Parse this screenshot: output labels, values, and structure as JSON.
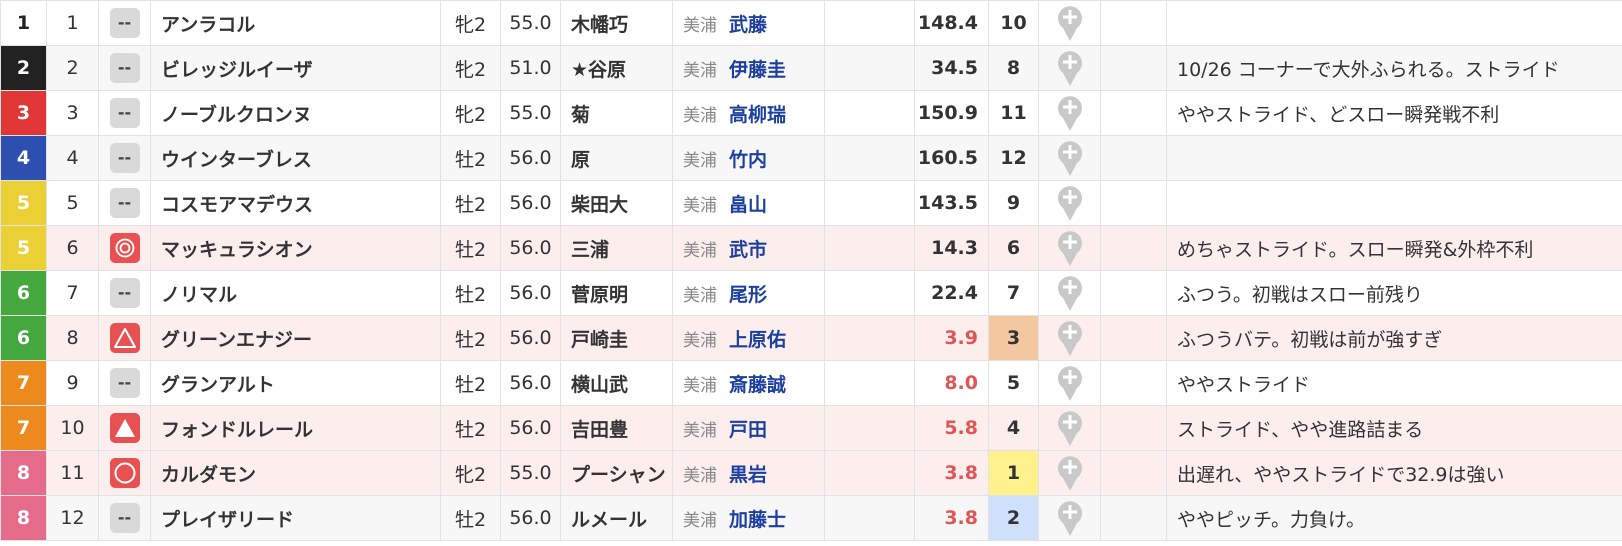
{
  "colors": {
    "waku": {
      "1": {
        "bg": "#ffffff",
        "fg": "#222222"
      },
      "2": {
        "bg": "#222222",
        "fg": "#ffffff"
      },
      "3": {
        "bg": "#e03636",
        "fg": "#ffffff"
      },
      "4": {
        "bg": "#2d4fb0",
        "fg": "#ffffff"
      },
      "5": {
        "bg": "#ead035",
        "fg": "#ffffff"
      },
      "6": {
        "bg": "#45a83e",
        "fg": "#ffffff"
      },
      "7": {
        "bg": "#ec8a1e",
        "fg": "#ffffff"
      },
      "8": {
        "bg": "#e46c8a",
        "fg": "#ffffff"
      }
    },
    "name_blue": "#1d3fa0",
    "odds_favored_red": "#e05656",
    "mark_red": "#e85151",
    "pop1_yellow": "#fff28c",
    "pop2_blue": "#cfe0fb",
    "pop3_orange": "#f3c8a0"
  },
  "runners": [
    {
      "waku": "1",
      "umaban": "1",
      "mark": "--",
      "mark_icon": "none-mark",
      "name": "アンラコル",
      "sex_age": "牝2",
      "weight": "55.0",
      "jockey": "木幡巧",
      "region": "美浦",
      "trainer": "武藤",
      "odds": "148.4",
      "odds_favored": false,
      "popularity": "10",
      "pin_icon": "add-pin-icon",
      "comment": "",
      "highlight": false
    },
    {
      "waku": "2",
      "umaban": "2",
      "mark": "--",
      "mark_icon": "none-mark",
      "name": "ビレッジルイーザ",
      "sex_age": "牝2",
      "weight": "51.0",
      "jockey": "★谷原",
      "region": "美浦",
      "trainer": "伊藤圭",
      "odds": "34.5",
      "odds_favored": false,
      "popularity": "8",
      "pin_icon": "add-pin-icon",
      "comment": "10/26 コーナーで大外ふられる。ストライド",
      "highlight": false
    },
    {
      "waku": "3",
      "umaban": "3",
      "mark": "--",
      "mark_icon": "none-mark",
      "name": "ノーブルクロンヌ",
      "sex_age": "牝2",
      "weight": "55.0",
      "jockey": "菊",
      "region": "美浦",
      "trainer": "高柳瑞",
      "odds": "150.9",
      "odds_favored": false,
      "popularity": "11",
      "pin_icon": "add-pin-icon",
      "comment": "ややストライド、どスロー瞬発戦不利",
      "highlight": false
    },
    {
      "waku": "4",
      "umaban": "4",
      "mark": "--",
      "mark_icon": "none-mark",
      "name": "ウインターブレス",
      "sex_age": "牡2",
      "weight": "56.0",
      "jockey": "原",
      "region": "美浦",
      "trainer": "竹内",
      "odds": "160.5",
      "odds_favored": false,
      "popularity": "12",
      "pin_icon": "add-pin-icon",
      "comment": "",
      "highlight": false
    },
    {
      "waku": "5",
      "umaban": "5",
      "mark": "--",
      "mark_icon": "none-mark",
      "name": "コスモアマデウス",
      "sex_age": "牡2",
      "weight": "56.0",
      "jockey": "柴田大",
      "region": "美浦",
      "trainer": "畠山",
      "odds": "143.5",
      "odds_favored": false,
      "popularity": "9",
      "pin_icon": "add-pin-icon",
      "comment": "",
      "highlight": false
    },
    {
      "waku": "5",
      "umaban": "6",
      "mark": "◎",
      "mark_icon": "double-circle-mark",
      "name": "マッキュラシオン",
      "sex_age": "牡2",
      "weight": "56.0",
      "jockey": "三浦",
      "region": "美浦",
      "trainer": "武市",
      "odds": "14.3",
      "odds_favored": false,
      "popularity": "6",
      "pin_icon": "add-pin-icon",
      "comment": "めちゃストライド。スロー瞬発&外枠不利",
      "highlight": true
    },
    {
      "waku": "6",
      "umaban": "7",
      "mark": "--",
      "mark_icon": "none-mark",
      "name": "ノリマル",
      "sex_age": "牡2",
      "weight": "56.0",
      "jockey": "菅原明",
      "region": "美浦",
      "trainer": "尾形",
      "odds": "22.4",
      "odds_favored": false,
      "popularity": "7",
      "pin_icon": "add-pin-icon",
      "comment": "ふつう。初戦はスロー前残り",
      "highlight": false
    },
    {
      "waku": "6",
      "umaban": "8",
      "mark": "△",
      "mark_icon": "triangle-outline-mark",
      "name": "グリーンエナジー",
      "sex_age": "牡2",
      "weight": "56.0",
      "jockey": "戸崎圭",
      "region": "美浦",
      "trainer": "上原佑",
      "odds": "3.9",
      "odds_favored": true,
      "popularity": "3",
      "pin_icon": "add-pin-icon",
      "comment": "ふつうバテ。初戦は前が強すぎ",
      "highlight": true
    },
    {
      "waku": "7",
      "umaban": "9",
      "mark": "--",
      "mark_icon": "none-mark",
      "name": "グランアルト",
      "sex_age": "牡2",
      "weight": "56.0",
      "jockey": "横山武",
      "region": "美浦",
      "trainer": "斎藤誠",
      "odds": "8.0",
      "odds_favored": true,
      "popularity": "5",
      "pin_icon": "add-pin-icon",
      "comment": "ややストライド",
      "highlight": false
    },
    {
      "waku": "7",
      "umaban": "10",
      "mark": "▲",
      "mark_icon": "triangle-filled-mark",
      "name": "フォンドルレール",
      "sex_age": "牡2",
      "weight": "56.0",
      "jockey": "吉田豊",
      "region": "美浦",
      "trainer": "戸田",
      "odds": "5.8",
      "odds_favored": true,
      "popularity": "4",
      "pin_icon": "add-pin-icon",
      "comment": "ストライド、やや進路詰まる",
      "highlight": true
    },
    {
      "waku": "8",
      "umaban": "11",
      "mark": "◯",
      "mark_icon": "circle-mark",
      "name": "カルダモン",
      "sex_age": "牝2",
      "weight": "55.0",
      "jockey": "プーシャン",
      "region": "美浦",
      "trainer": "黒岩",
      "odds": "3.8",
      "odds_favored": true,
      "popularity": "1",
      "pin_icon": "add-pin-icon",
      "comment": "出遅れ、ややストライドで32.9は強い",
      "highlight": true
    },
    {
      "waku": "8",
      "umaban": "12",
      "mark": "--",
      "mark_icon": "none-mark",
      "name": "プレイザリード",
      "sex_age": "牡2",
      "weight": "56.0",
      "jockey": "ルメール",
      "region": "美浦",
      "trainer": "加藤士",
      "odds": "3.8",
      "odds_favored": true,
      "popularity": "2",
      "pin_icon": "add-pin-icon",
      "comment": "ややピッチ。力負け。",
      "highlight": false
    }
  ]
}
